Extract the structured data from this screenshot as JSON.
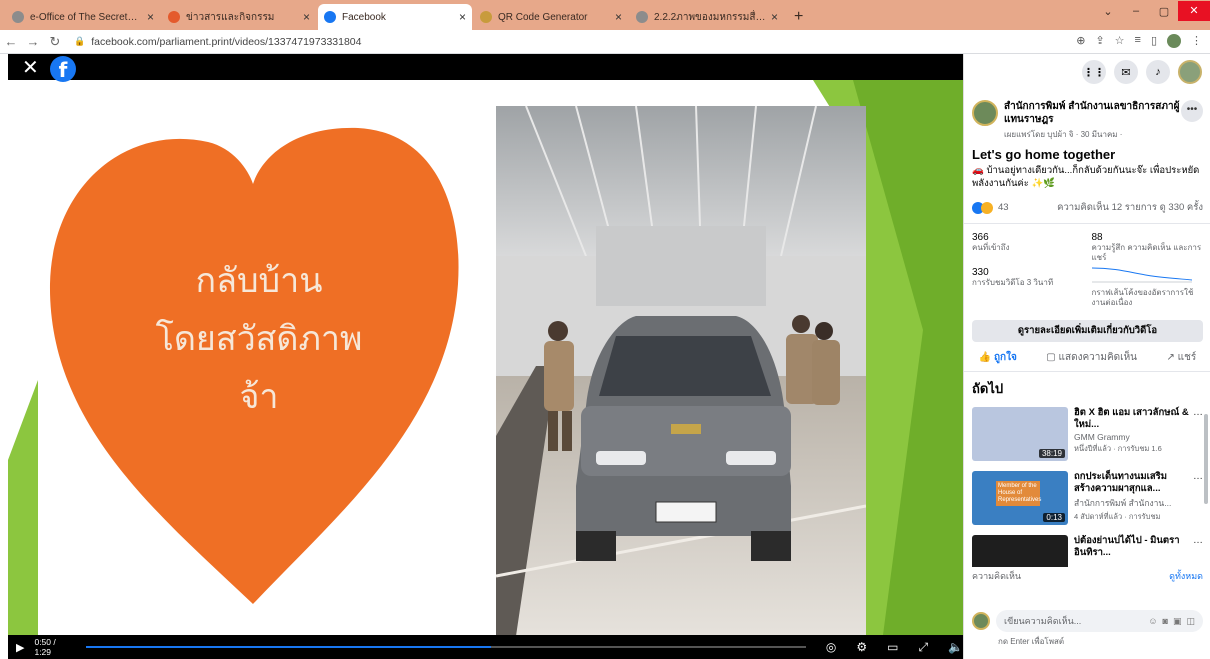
{
  "browser": {
    "tabs": [
      {
        "label": "e-Office of The Secretariat of The",
        "color": "#8c8c8c",
        "active": false
      },
      {
        "label": "ข่าวสารและกิจกรรม",
        "color": "#e45a2c",
        "active": false
      },
      {
        "label": "Facebook",
        "color": "#1877f2",
        "active": true
      },
      {
        "label": "QR Code Generator",
        "color": "#c89b3c",
        "active": false
      },
      {
        "label": "2.2.2ภาพของมหกรรมสื่อสารภายในใจ...",
        "color": "#8c8c8c",
        "active": false
      }
    ],
    "new_tab": "+",
    "url": "facebook.com/parliament.print/videos/1337471973331804"
  },
  "video": {
    "heart_lines": [
      "กลับบ้าน",
      "โดยสวัสดิภาพ",
      "จ้า"
    ],
    "time": "0:50 / 1:29",
    "progress": 0.5618,
    "plate": "กขค 8491"
  },
  "post": {
    "page_name": "สำนักการพิมพ์ สำนักงานเลขาธิการสภาผู้แทนราษฎร",
    "meta": "เผยแพร่โดย บุปผ้า จิ · 30 มีนาคม ·",
    "title": "Let's go home together",
    "description": "🚗 บ้านอยู่ทางเดียวกัน...ก็กลับด้วยกันนะจ๊ะ เพื่อประหยัดพลังงานกันค่ะ ✨🌿",
    "reaction_count": "43",
    "stats_right": "ความคิดเห็น 12 รายการ  ดู 330 ครั้ง",
    "stats": [
      {
        "num": "366",
        "label": "คนที่เข้าถึง"
      },
      {
        "num": "88",
        "label": "ความรู้สึก ความคิดเห็น และการแชร์"
      },
      {
        "num": "330",
        "label": "การรับชมวิดีโอ 3 วินาที"
      },
      {
        "num": "",
        "label": "กราฟเส้นโค้งของอัตราการใช้งานต่อเนื่อง"
      }
    ],
    "details_button": "ดูรายละเอียดเพิ่มเติมเกี่ยวกับวิดีโอ",
    "actions": {
      "like": "ถูกใจ",
      "comment": "แสดงความคิดเห็น",
      "share": "แชร์"
    }
  },
  "up_next": {
    "heading": "ถัดไป",
    "items": [
      {
        "title": "ฮิต X ฮิต แอม เสาวลักษณ์ & ใหม่...",
        "channel": "GMM Grammy",
        "meta": "หนึ่งปีที่แล้ว · การรับชม 1.6",
        "duration": "38:19",
        "thumb_color": "#b9c6df"
      },
      {
        "title": "ถกประเด็นทางนมเสริม สร้างความผาสุกแล...",
        "channel": "สำนักการพิมพ์ สำนักงาน...",
        "meta": "4 สัปดาห์ที่แล้ว · การรับชม",
        "duration": "0:13",
        "thumb_color": "#3a7fc2"
      },
      {
        "title": "บ่ต้องย่านบ่ได้ไป - มินตรา อินทิรา...",
        "channel": "",
        "meta": "",
        "duration": "",
        "thumb_color": "#1e1e1e"
      }
    ],
    "thumb2_caption": "Member of the House of Representatives"
  },
  "comments": {
    "label": "ความคิดเห็น",
    "see_all": "ดูทั้งหมด",
    "placeholder": "เขียนความคิดเห็น...",
    "hint": "กด Enter เพื่อโพสต์"
  },
  "colors": {
    "accent": "#1877f2",
    "tabbar": "#e7a88a",
    "heart": "#ef6f25",
    "green": "#8cc63f"
  }
}
